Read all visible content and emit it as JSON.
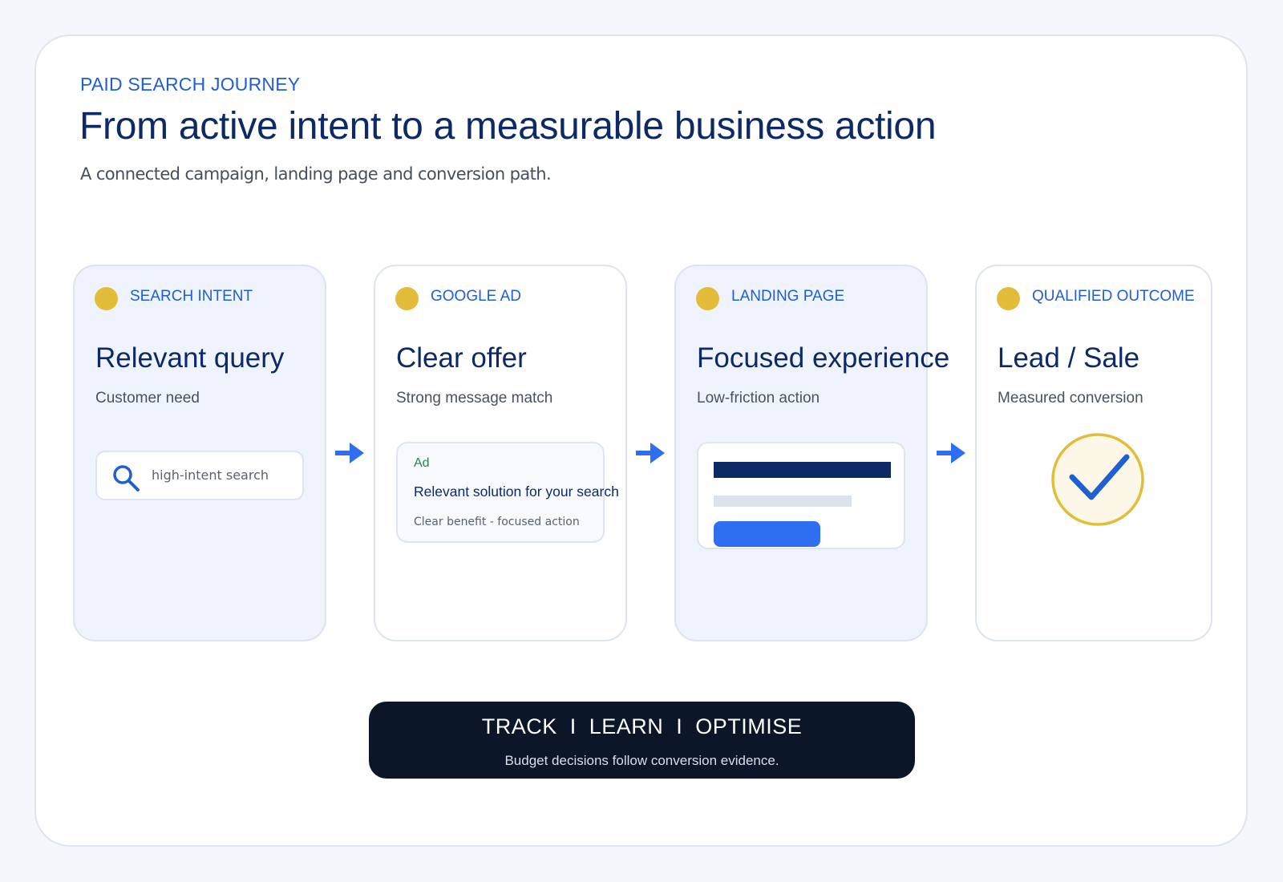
{
  "header": {
    "eyebrow": "PAID SEARCH JOURNEY",
    "title": "From active intent to a measurable business action",
    "subtitle": "A connected campaign, landing page and conversion path."
  },
  "steps": [
    {
      "tag": "SEARCH INTENT",
      "title": "Relevant query",
      "subtitle": "Customer need"
    },
    {
      "tag": "GOOGLE AD",
      "title": "Clear offer",
      "subtitle": "Strong message match"
    },
    {
      "tag": "LANDING PAGE",
      "title": "Focused experience",
      "subtitle": "Low-friction action"
    },
    {
      "tag": "QUALIFIED OUTCOME",
      "title": "Lead / Sale",
      "subtitle": "Measured conversion"
    }
  ],
  "search_box": {
    "text": "high-intent search",
    "icon": "search-icon"
  },
  "ad_preview": {
    "label": "Ad",
    "title": "Relevant solution for your search",
    "description": "Clear benefit - focused action"
  },
  "outcome": {
    "icon": "check-icon"
  },
  "connector": {
    "icon": "arrow-right-icon"
  },
  "banner": {
    "title": "TRACK  I  LEARN  I  OPTIMISE",
    "subtitle": "Budget decisions follow conversion evidence."
  },
  "colors": {
    "accent_blue": "#1f5fd1",
    "navy": "#0d2a66",
    "gold": "#e3bd3a",
    "button_blue": "#2f6ef0",
    "banner_bg": "#0b1628",
    "tint_card": "#eef3fe"
  }
}
